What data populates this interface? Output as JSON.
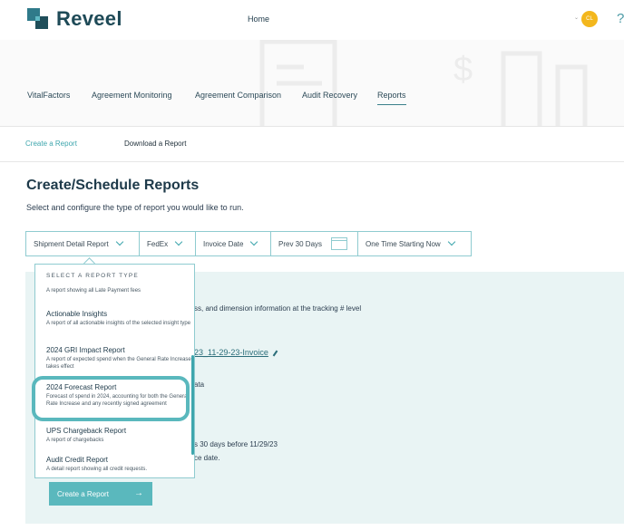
{
  "app": {
    "brand": "Reveel",
    "home_label": "Home",
    "avatar_initials": "CL",
    "help_icon": "?"
  },
  "nav": {
    "items": [
      "VitalFactors",
      "Agreement Monitoring",
      "Agreement Comparison",
      "Audit Recovery",
      "Reports"
    ],
    "active": "Reports"
  },
  "tabs": {
    "create": "Create a Report",
    "download": "Download a Report"
  },
  "page": {
    "title": "Create/Schedule Reports",
    "subtitle": "Select and configure the type of report you would like to run."
  },
  "filters": {
    "report_type": "Shipment Detail Report",
    "carrier": "FedEx",
    "date_type": "Invoice Date",
    "period": "Prev 30 Days",
    "schedule": "One Time Starting Now"
  },
  "dropdown": {
    "header": "SELECT A REPORT TYPE",
    "partial_desc": "A report showing all Late Payment fees",
    "items": [
      {
        "title": "Actionable Insights",
        "desc": "A report of all actionable insights of the selected insight type"
      },
      {
        "title": "2024 GRI Impact Report",
        "desc": "A report of expected spend when the General Rate Increase takes effect"
      },
      {
        "title": "2024 Forecast Report",
        "desc": "Forecast of spend in 2024, accounting for both the General Rate Increase and any recently signed agreement"
      },
      {
        "title": "UPS Chargeback Report",
        "desc": "A report of chargebacks"
      },
      {
        "title": "Audit Credit Report",
        "desc": "A detail report showing all credit requests."
      }
    ]
  },
  "panel": {
    "line1": "ss, and dimension information at the tracking # level",
    "filename": "23_11-29-23-Invoice",
    "line2": "ata",
    "line3": "s 30 days before 11/29/23",
    "line4": "ce date."
  },
  "create_button": "Create a Report",
  "colors": {
    "accent": "#5ab8bd",
    "brand": "#1e4a57",
    "avatar": "#f3b71d",
    "panel_bg": "#e9f4f4"
  }
}
